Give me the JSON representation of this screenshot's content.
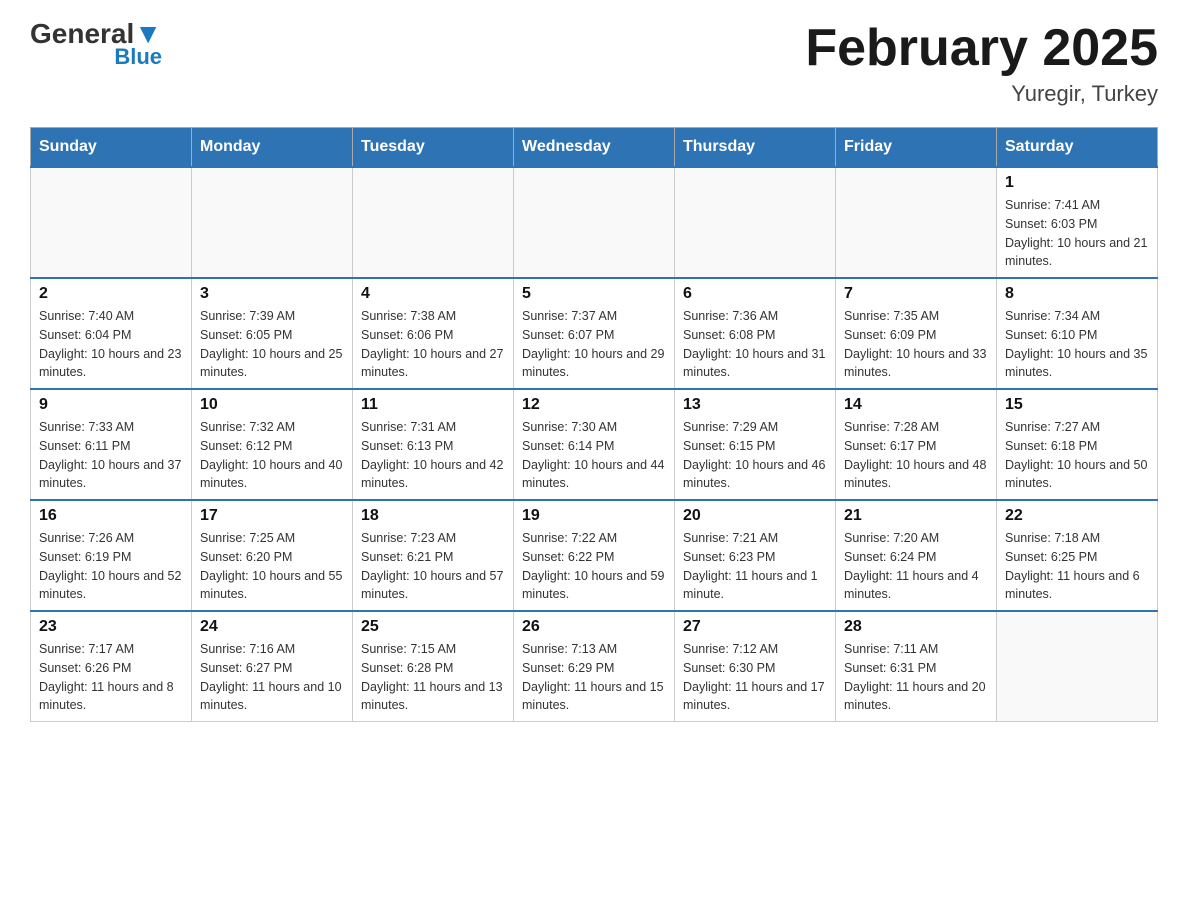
{
  "header": {
    "logo_general": "General",
    "logo_blue": "Blue",
    "month_title": "February 2025",
    "location": "Yuregir, Turkey"
  },
  "days_of_week": [
    "Sunday",
    "Monday",
    "Tuesday",
    "Wednesday",
    "Thursday",
    "Friday",
    "Saturday"
  ],
  "weeks": [
    {
      "days": [
        {
          "number": "",
          "empty": true
        },
        {
          "number": "",
          "empty": true
        },
        {
          "number": "",
          "empty": true
        },
        {
          "number": "",
          "empty": true
        },
        {
          "number": "",
          "empty": true
        },
        {
          "number": "",
          "empty": true
        },
        {
          "number": "1",
          "sunrise": "Sunrise: 7:41 AM",
          "sunset": "Sunset: 6:03 PM",
          "daylight": "Daylight: 10 hours and 21 minutes."
        }
      ]
    },
    {
      "days": [
        {
          "number": "2",
          "sunrise": "Sunrise: 7:40 AM",
          "sunset": "Sunset: 6:04 PM",
          "daylight": "Daylight: 10 hours and 23 minutes."
        },
        {
          "number": "3",
          "sunrise": "Sunrise: 7:39 AM",
          "sunset": "Sunset: 6:05 PM",
          "daylight": "Daylight: 10 hours and 25 minutes."
        },
        {
          "number": "4",
          "sunrise": "Sunrise: 7:38 AM",
          "sunset": "Sunset: 6:06 PM",
          "daylight": "Daylight: 10 hours and 27 minutes."
        },
        {
          "number": "5",
          "sunrise": "Sunrise: 7:37 AM",
          "sunset": "Sunset: 6:07 PM",
          "daylight": "Daylight: 10 hours and 29 minutes."
        },
        {
          "number": "6",
          "sunrise": "Sunrise: 7:36 AM",
          "sunset": "Sunset: 6:08 PM",
          "daylight": "Daylight: 10 hours and 31 minutes."
        },
        {
          "number": "7",
          "sunrise": "Sunrise: 7:35 AM",
          "sunset": "Sunset: 6:09 PM",
          "daylight": "Daylight: 10 hours and 33 minutes."
        },
        {
          "number": "8",
          "sunrise": "Sunrise: 7:34 AM",
          "sunset": "Sunset: 6:10 PM",
          "daylight": "Daylight: 10 hours and 35 minutes."
        }
      ]
    },
    {
      "days": [
        {
          "number": "9",
          "sunrise": "Sunrise: 7:33 AM",
          "sunset": "Sunset: 6:11 PM",
          "daylight": "Daylight: 10 hours and 37 minutes."
        },
        {
          "number": "10",
          "sunrise": "Sunrise: 7:32 AM",
          "sunset": "Sunset: 6:12 PM",
          "daylight": "Daylight: 10 hours and 40 minutes."
        },
        {
          "number": "11",
          "sunrise": "Sunrise: 7:31 AM",
          "sunset": "Sunset: 6:13 PM",
          "daylight": "Daylight: 10 hours and 42 minutes."
        },
        {
          "number": "12",
          "sunrise": "Sunrise: 7:30 AM",
          "sunset": "Sunset: 6:14 PM",
          "daylight": "Daylight: 10 hours and 44 minutes."
        },
        {
          "number": "13",
          "sunrise": "Sunrise: 7:29 AM",
          "sunset": "Sunset: 6:15 PM",
          "daylight": "Daylight: 10 hours and 46 minutes."
        },
        {
          "number": "14",
          "sunrise": "Sunrise: 7:28 AM",
          "sunset": "Sunset: 6:17 PM",
          "daylight": "Daylight: 10 hours and 48 minutes."
        },
        {
          "number": "15",
          "sunrise": "Sunrise: 7:27 AM",
          "sunset": "Sunset: 6:18 PM",
          "daylight": "Daylight: 10 hours and 50 minutes."
        }
      ]
    },
    {
      "days": [
        {
          "number": "16",
          "sunrise": "Sunrise: 7:26 AM",
          "sunset": "Sunset: 6:19 PM",
          "daylight": "Daylight: 10 hours and 52 minutes."
        },
        {
          "number": "17",
          "sunrise": "Sunrise: 7:25 AM",
          "sunset": "Sunset: 6:20 PM",
          "daylight": "Daylight: 10 hours and 55 minutes."
        },
        {
          "number": "18",
          "sunrise": "Sunrise: 7:23 AM",
          "sunset": "Sunset: 6:21 PM",
          "daylight": "Daylight: 10 hours and 57 minutes."
        },
        {
          "number": "19",
          "sunrise": "Sunrise: 7:22 AM",
          "sunset": "Sunset: 6:22 PM",
          "daylight": "Daylight: 10 hours and 59 minutes."
        },
        {
          "number": "20",
          "sunrise": "Sunrise: 7:21 AM",
          "sunset": "Sunset: 6:23 PM",
          "daylight": "Daylight: 11 hours and 1 minute."
        },
        {
          "number": "21",
          "sunrise": "Sunrise: 7:20 AM",
          "sunset": "Sunset: 6:24 PM",
          "daylight": "Daylight: 11 hours and 4 minutes."
        },
        {
          "number": "22",
          "sunrise": "Sunrise: 7:18 AM",
          "sunset": "Sunset: 6:25 PM",
          "daylight": "Daylight: 11 hours and 6 minutes."
        }
      ]
    },
    {
      "days": [
        {
          "number": "23",
          "sunrise": "Sunrise: 7:17 AM",
          "sunset": "Sunset: 6:26 PM",
          "daylight": "Daylight: 11 hours and 8 minutes."
        },
        {
          "number": "24",
          "sunrise": "Sunrise: 7:16 AM",
          "sunset": "Sunset: 6:27 PM",
          "daylight": "Daylight: 11 hours and 10 minutes."
        },
        {
          "number": "25",
          "sunrise": "Sunrise: 7:15 AM",
          "sunset": "Sunset: 6:28 PM",
          "daylight": "Daylight: 11 hours and 13 minutes."
        },
        {
          "number": "26",
          "sunrise": "Sunrise: 7:13 AM",
          "sunset": "Sunset: 6:29 PM",
          "daylight": "Daylight: 11 hours and 15 minutes."
        },
        {
          "number": "27",
          "sunrise": "Sunrise: 7:12 AM",
          "sunset": "Sunset: 6:30 PM",
          "daylight": "Daylight: 11 hours and 17 minutes."
        },
        {
          "number": "28",
          "sunrise": "Sunrise: 7:11 AM",
          "sunset": "Sunset: 6:31 PM",
          "daylight": "Daylight: 11 hours and 20 minutes."
        },
        {
          "number": "",
          "empty": true
        }
      ]
    }
  ]
}
